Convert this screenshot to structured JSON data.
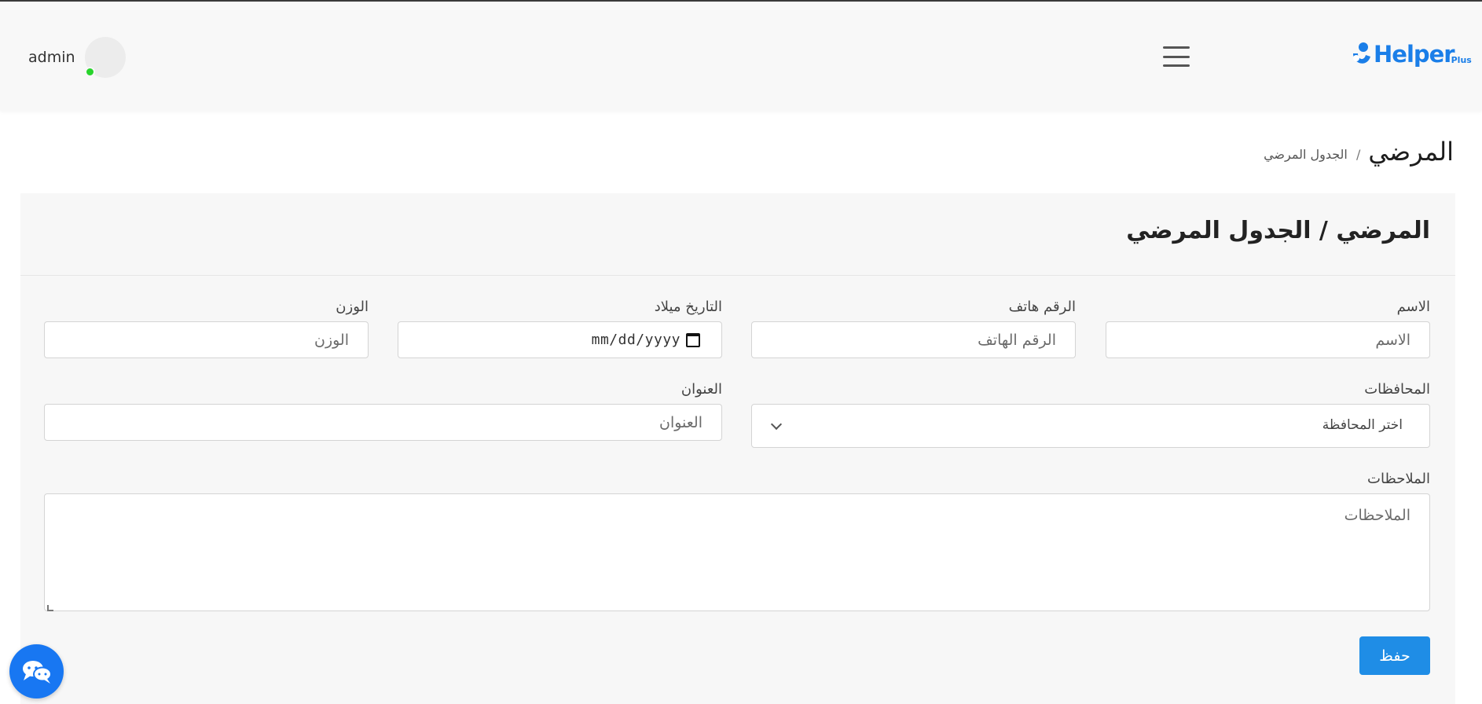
{
  "header": {
    "username": "admin",
    "logo_text": "Helper",
    "logo_sub": "Plus"
  },
  "page": {
    "title": "المرضي",
    "breadcrumb_sep": "/",
    "breadcrumb_current": "الجدول المرضي"
  },
  "card": {
    "title": "المرضي / الجدول المرضي"
  },
  "form": {
    "name": {
      "label": "الاسم",
      "placeholder": "الاسم"
    },
    "phone": {
      "label": "الرقم هاتف",
      "placeholder": "الرقم الهاتف"
    },
    "birthdate": {
      "label": "التاريخ ميلاد",
      "value": "mm/dd/yyyy"
    },
    "weight": {
      "label": "الوزن",
      "placeholder": "الوزن"
    },
    "governorate": {
      "label": "المحافظات",
      "selected": "اختر المحافظة"
    },
    "address": {
      "label": "العنوان",
      "placeholder": "العنوان"
    },
    "notes": {
      "label": "الملاحظات",
      "placeholder": "الملاحظات"
    },
    "save_label": "حفظ"
  },
  "colors": {
    "accent": "#1f8de6",
    "brand": "#1a7ee8",
    "online": "#28d42c"
  },
  "icons": {
    "menu": "hamburger-icon",
    "calendar": "calendar-icon",
    "chat": "chat-icon",
    "chevron": "chevron-down-icon"
  }
}
